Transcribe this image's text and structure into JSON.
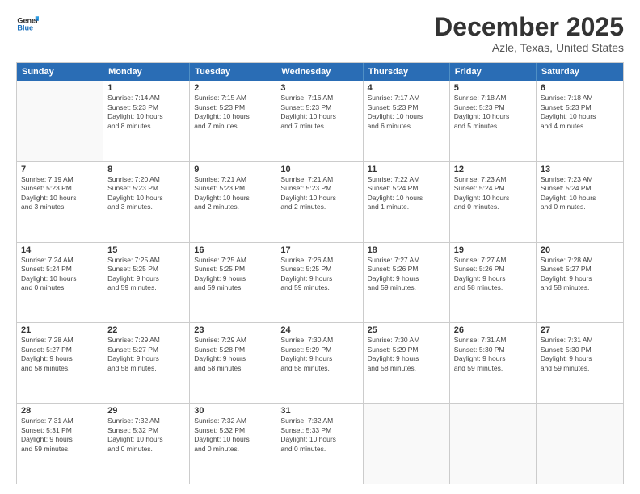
{
  "header": {
    "logo_general": "General",
    "logo_blue": "Blue",
    "month": "December 2025",
    "location": "Azle, Texas, United States"
  },
  "weekdays": [
    "Sunday",
    "Monday",
    "Tuesday",
    "Wednesday",
    "Thursday",
    "Friday",
    "Saturday"
  ],
  "rows": [
    [
      {
        "empty": true
      },
      {
        "day": "1",
        "info": "Sunrise: 7:14 AM\nSunset: 5:23 PM\nDaylight: 10 hours\nand 8 minutes."
      },
      {
        "day": "2",
        "info": "Sunrise: 7:15 AM\nSunset: 5:23 PM\nDaylight: 10 hours\nand 7 minutes."
      },
      {
        "day": "3",
        "info": "Sunrise: 7:16 AM\nSunset: 5:23 PM\nDaylight: 10 hours\nand 7 minutes."
      },
      {
        "day": "4",
        "info": "Sunrise: 7:17 AM\nSunset: 5:23 PM\nDaylight: 10 hours\nand 6 minutes."
      },
      {
        "day": "5",
        "info": "Sunrise: 7:18 AM\nSunset: 5:23 PM\nDaylight: 10 hours\nand 5 minutes."
      },
      {
        "day": "6",
        "info": "Sunrise: 7:18 AM\nSunset: 5:23 PM\nDaylight: 10 hours\nand 4 minutes."
      }
    ],
    [
      {
        "day": "7",
        "info": "Sunrise: 7:19 AM\nSunset: 5:23 PM\nDaylight: 10 hours\nand 3 minutes."
      },
      {
        "day": "8",
        "info": "Sunrise: 7:20 AM\nSunset: 5:23 PM\nDaylight: 10 hours\nand 3 minutes."
      },
      {
        "day": "9",
        "info": "Sunrise: 7:21 AM\nSunset: 5:23 PM\nDaylight: 10 hours\nand 2 minutes."
      },
      {
        "day": "10",
        "info": "Sunrise: 7:21 AM\nSunset: 5:23 PM\nDaylight: 10 hours\nand 2 minutes."
      },
      {
        "day": "11",
        "info": "Sunrise: 7:22 AM\nSunset: 5:24 PM\nDaylight: 10 hours\nand 1 minute."
      },
      {
        "day": "12",
        "info": "Sunrise: 7:23 AM\nSunset: 5:24 PM\nDaylight: 10 hours\nand 0 minutes."
      },
      {
        "day": "13",
        "info": "Sunrise: 7:23 AM\nSunset: 5:24 PM\nDaylight: 10 hours\nand 0 minutes."
      }
    ],
    [
      {
        "day": "14",
        "info": "Sunrise: 7:24 AM\nSunset: 5:24 PM\nDaylight: 10 hours\nand 0 minutes."
      },
      {
        "day": "15",
        "info": "Sunrise: 7:25 AM\nSunset: 5:25 PM\nDaylight: 9 hours\nand 59 minutes."
      },
      {
        "day": "16",
        "info": "Sunrise: 7:25 AM\nSunset: 5:25 PM\nDaylight: 9 hours\nand 59 minutes."
      },
      {
        "day": "17",
        "info": "Sunrise: 7:26 AM\nSunset: 5:25 PM\nDaylight: 9 hours\nand 59 minutes."
      },
      {
        "day": "18",
        "info": "Sunrise: 7:27 AM\nSunset: 5:26 PM\nDaylight: 9 hours\nand 59 minutes."
      },
      {
        "day": "19",
        "info": "Sunrise: 7:27 AM\nSunset: 5:26 PM\nDaylight: 9 hours\nand 58 minutes."
      },
      {
        "day": "20",
        "info": "Sunrise: 7:28 AM\nSunset: 5:27 PM\nDaylight: 9 hours\nand 58 minutes."
      }
    ],
    [
      {
        "day": "21",
        "info": "Sunrise: 7:28 AM\nSunset: 5:27 PM\nDaylight: 9 hours\nand 58 minutes."
      },
      {
        "day": "22",
        "info": "Sunrise: 7:29 AM\nSunset: 5:27 PM\nDaylight: 9 hours\nand 58 minutes."
      },
      {
        "day": "23",
        "info": "Sunrise: 7:29 AM\nSunset: 5:28 PM\nDaylight: 9 hours\nand 58 minutes."
      },
      {
        "day": "24",
        "info": "Sunrise: 7:30 AM\nSunset: 5:29 PM\nDaylight: 9 hours\nand 58 minutes."
      },
      {
        "day": "25",
        "info": "Sunrise: 7:30 AM\nSunset: 5:29 PM\nDaylight: 9 hours\nand 58 minutes."
      },
      {
        "day": "26",
        "info": "Sunrise: 7:31 AM\nSunset: 5:30 PM\nDaylight: 9 hours\nand 59 minutes."
      },
      {
        "day": "27",
        "info": "Sunrise: 7:31 AM\nSunset: 5:30 PM\nDaylight: 9 hours\nand 59 minutes."
      }
    ],
    [
      {
        "day": "28",
        "info": "Sunrise: 7:31 AM\nSunset: 5:31 PM\nDaylight: 9 hours\nand 59 minutes."
      },
      {
        "day": "29",
        "info": "Sunrise: 7:32 AM\nSunset: 5:32 PM\nDaylight: 10 hours\nand 0 minutes."
      },
      {
        "day": "30",
        "info": "Sunrise: 7:32 AM\nSunset: 5:32 PM\nDaylight: 10 hours\nand 0 minutes."
      },
      {
        "day": "31",
        "info": "Sunrise: 7:32 AM\nSunset: 5:33 PM\nDaylight: 10 hours\nand 0 minutes."
      },
      {
        "empty": true
      },
      {
        "empty": true
      },
      {
        "empty": true
      }
    ]
  ]
}
